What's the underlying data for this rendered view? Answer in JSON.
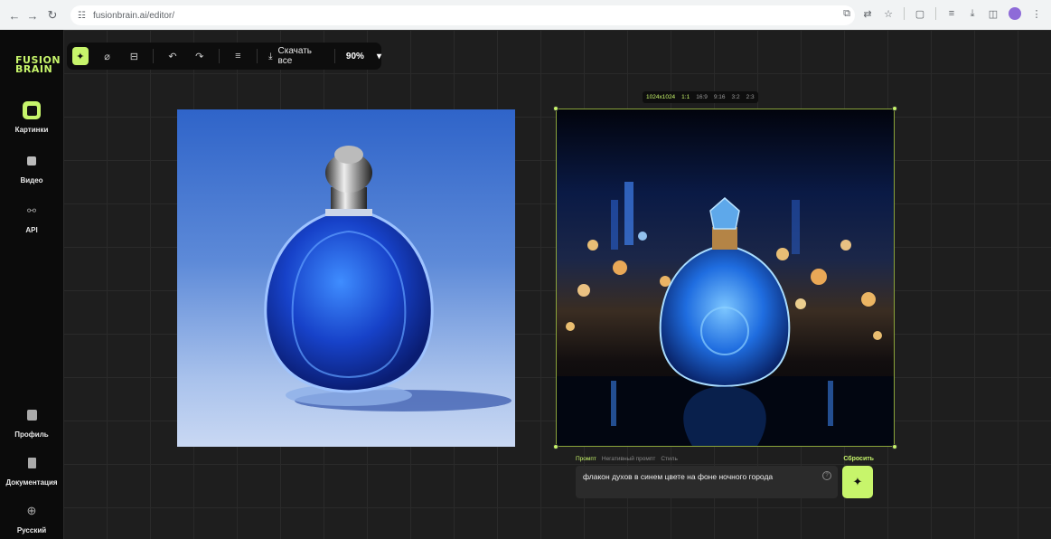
{
  "browser": {
    "url": "fusionbrain.ai/editor/",
    "back_icon": "←",
    "forward_icon": "→",
    "reload_icon": "↻",
    "site_icon": "☷"
  },
  "sidebar": {
    "logo_line1": "FUSION",
    "logo_line2": "BRAIN",
    "items": [
      {
        "label": "Картинки",
        "icon": "image-icon"
      },
      {
        "label": "Видео",
        "icon": "video-icon"
      },
      {
        "label": "API",
        "icon": "api-icon"
      }
    ],
    "bottom_items": [
      {
        "label": "Профиль",
        "icon": "profile-icon"
      },
      {
        "label": "Документация",
        "icon": "document-icon"
      },
      {
        "label": "Русский",
        "icon": "globe-icon"
      }
    ]
  },
  "toolbar": {
    "download_label": "Скачать все",
    "zoom_value": "90%"
  },
  "image_sizes": {
    "resolution": "1024x1024",
    "ratios": [
      "1:1",
      "16:9",
      "9:16",
      "3:2",
      "2:3"
    ]
  },
  "prompt": {
    "tabs": [
      "Промпт",
      "Негативный промпт",
      "Стиль"
    ],
    "reset_label": "Сбросить",
    "text": "флакон духов в синем цвете на фоне ночного города"
  },
  "colors": {
    "accent": "#c7f56b",
    "sidebar_bg": "#0b0b0b",
    "canvas_bg": "#1e1e1e"
  }
}
